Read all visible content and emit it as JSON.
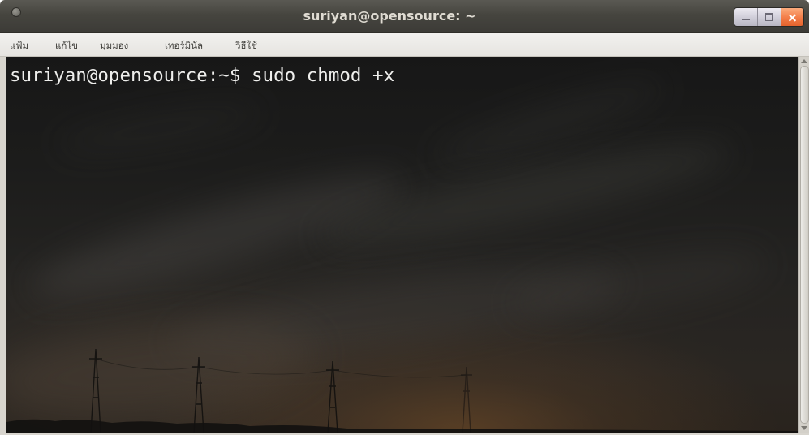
{
  "window": {
    "title": "suriyan@opensource: ~",
    "controls": {
      "menu_icon": "window-menu-icon",
      "minimize_icon": "minimize-icon",
      "maximize_icon": "maximize-icon",
      "close_icon": "close-icon"
    }
  },
  "menu": {
    "items": [
      {
        "label": "แฟ้ม"
      },
      {
        "label": "แก้ไข"
      },
      {
        "label": "มุมมอง"
      },
      {
        "label": "เทอร์มินัล"
      },
      {
        "label": "วิธีใช้"
      }
    ]
  },
  "terminal": {
    "lines": [
      {
        "prompt": "suriyan@opensource:~$",
        "command": "sudo chmod +x"
      }
    ]
  },
  "colors": {
    "titlebar": "#3c3b37",
    "title_text": "#dfdbd2",
    "menubar": "#edebe8",
    "terminal_text": "#eeeeec",
    "close_button": "#f37c47"
  }
}
